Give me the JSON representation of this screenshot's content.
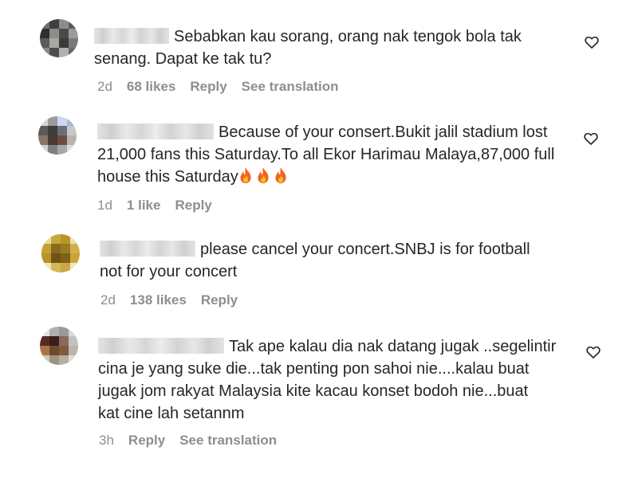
{
  "comments": [
    {
      "text_line1": "Sebabkan kau sorang, orang nak tengok bola tak",
      "text_line2": "senang. Dapat ke tak tu?",
      "time": "2d",
      "likes": "68 likes",
      "reply": "Reply",
      "translate": "See translation"
    },
    {
      "text_line1": "Because of your consert.Bukit jalil stadium lost",
      "text_line2": "21,000 fans this Saturday.To all Ekor Harimau Malaya,87,000 full",
      "text_line3": "house this Saturday",
      "time": "1d",
      "likes": "1 like",
      "reply": "Reply"
    },
    {
      "text_line1": "please cancel your concert.SNBJ is for football",
      "text_line2": "not for your concert",
      "time": "2d",
      "likes": "138 likes",
      "reply": "Reply"
    },
    {
      "text_line1": "Tak ape kalau dia nak datang jugak ..segelintir",
      "text_line2": "cina je yang suke die...tak penting pon sahoi nie....kalau buat",
      "text_line3": "jugak jom rakyat Malaysia kite kacau konset bodoh nie...buat",
      "text_line4": "kat cine lah setannm",
      "time": "3h",
      "reply": "Reply",
      "translate": "See translation"
    }
  ],
  "icons": {
    "like": "heart-outline-icon",
    "emoji": "fire-emoji"
  },
  "colors": {
    "text": "#262626",
    "meta": "#8e8e8e"
  }
}
